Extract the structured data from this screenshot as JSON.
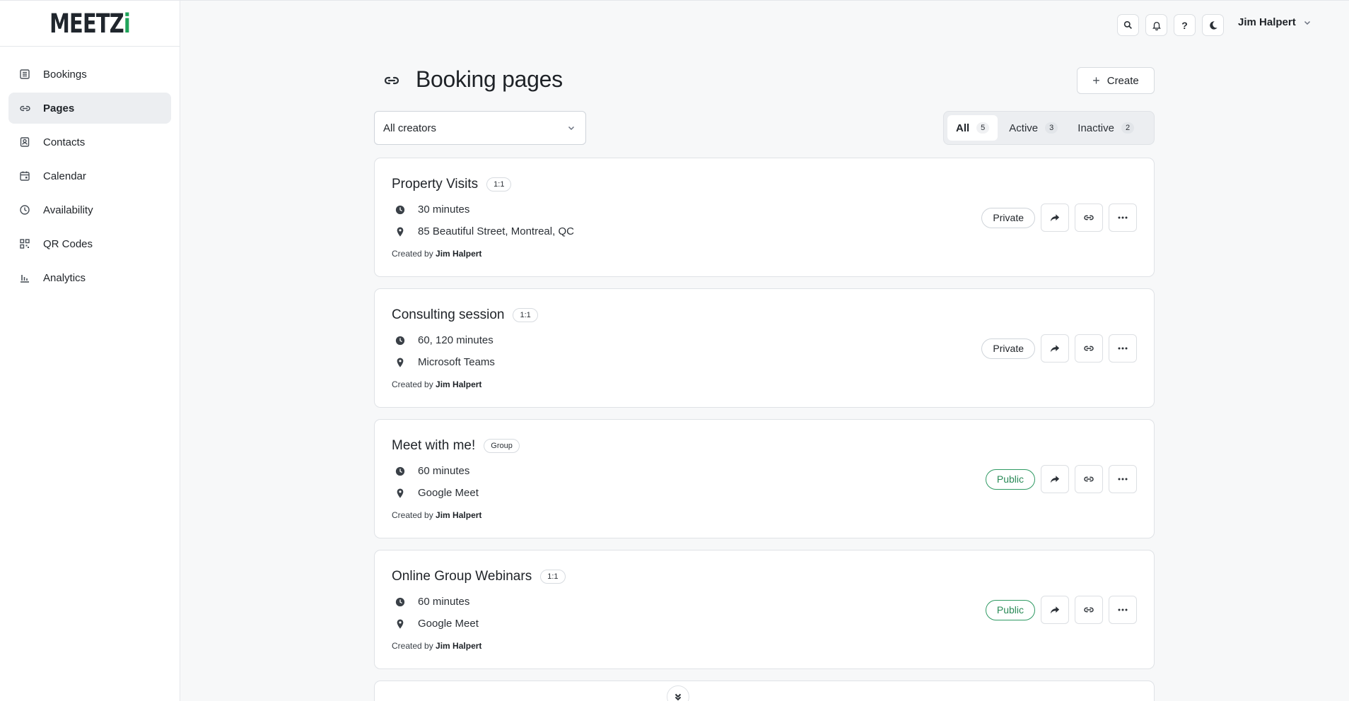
{
  "app": {
    "logo_main": "MEETZ",
    "logo_accent": "i"
  },
  "sidebar": {
    "items": [
      {
        "label": "Bookings",
        "icon": "list-icon",
        "active": false
      },
      {
        "label": "Pages",
        "icon": "link-icon",
        "active": true
      },
      {
        "label": "Contacts",
        "icon": "contacts-icon",
        "active": false
      },
      {
        "label": "Calendar",
        "icon": "calendar-icon",
        "active": false
      },
      {
        "label": "Availability",
        "icon": "clock-icon",
        "active": false
      },
      {
        "label": "QR Codes",
        "icon": "qr-code-icon",
        "active": false
      },
      {
        "label": "Analytics",
        "icon": "bar-chart-icon",
        "active": false
      }
    ]
  },
  "topbar": {
    "search_icon": "search-icon",
    "bell_icon": "bell-icon",
    "help_label": "?",
    "theme_icon": "moon-icon",
    "user_name": "Jim Halpert"
  },
  "header": {
    "title": "Booking pages",
    "create_label": "Create"
  },
  "filters": {
    "creator_selected": "All creators",
    "tabs": [
      {
        "label": "All",
        "count": "5",
        "active": true
      },
      {
        "label": "Active",
        "count": "3",
        "active": false
      },
      {
        "label": "Inactive",
        "count": "2",
        "active": false
      }
    ]
  },
  "cards": [
    {
      "title": "Property Visits",
      "type": "1:1",
      "duration": "30 minutes",
      "location": "85 Beautiful Street, Montreal, QC",
      "created_prefix": "Created by",
      "creator": "Jim Halpert",
      "visibility": "Private"
    },
    {
      "title": "Consulting session",
      "type": "1:1",
      "duration": "60, 120 minutes",
      "location": "Microsoft Teams",
      "created_prefix": "Created by",
      "creator": "Jim Halpert",
      "visibility": "Private"
    },
    {
      "title": "Meet with me!",
      "type": "Group",
      "duration": "60 minutes",
      "location": "Google Meet",
      "created_prefix": "Created by",
      "creator": "Jim Halpert",
      "visibility": "Public"
    },
    {
      "title": "Online Group Webinars",
      "type": "1:1",
      "duration": "60 minutes",
      "location": "Google Meet",
      "created_prefix": "Created by",
      "creator": "Jim Halpert",
      "visibility": "Public"
    }
  ],
  "colors": {
    "accent_green": "#1fa35a",
    "public_green": "#2a8a57",
    "active_nav_bg": "#eceef1"
  }
}
